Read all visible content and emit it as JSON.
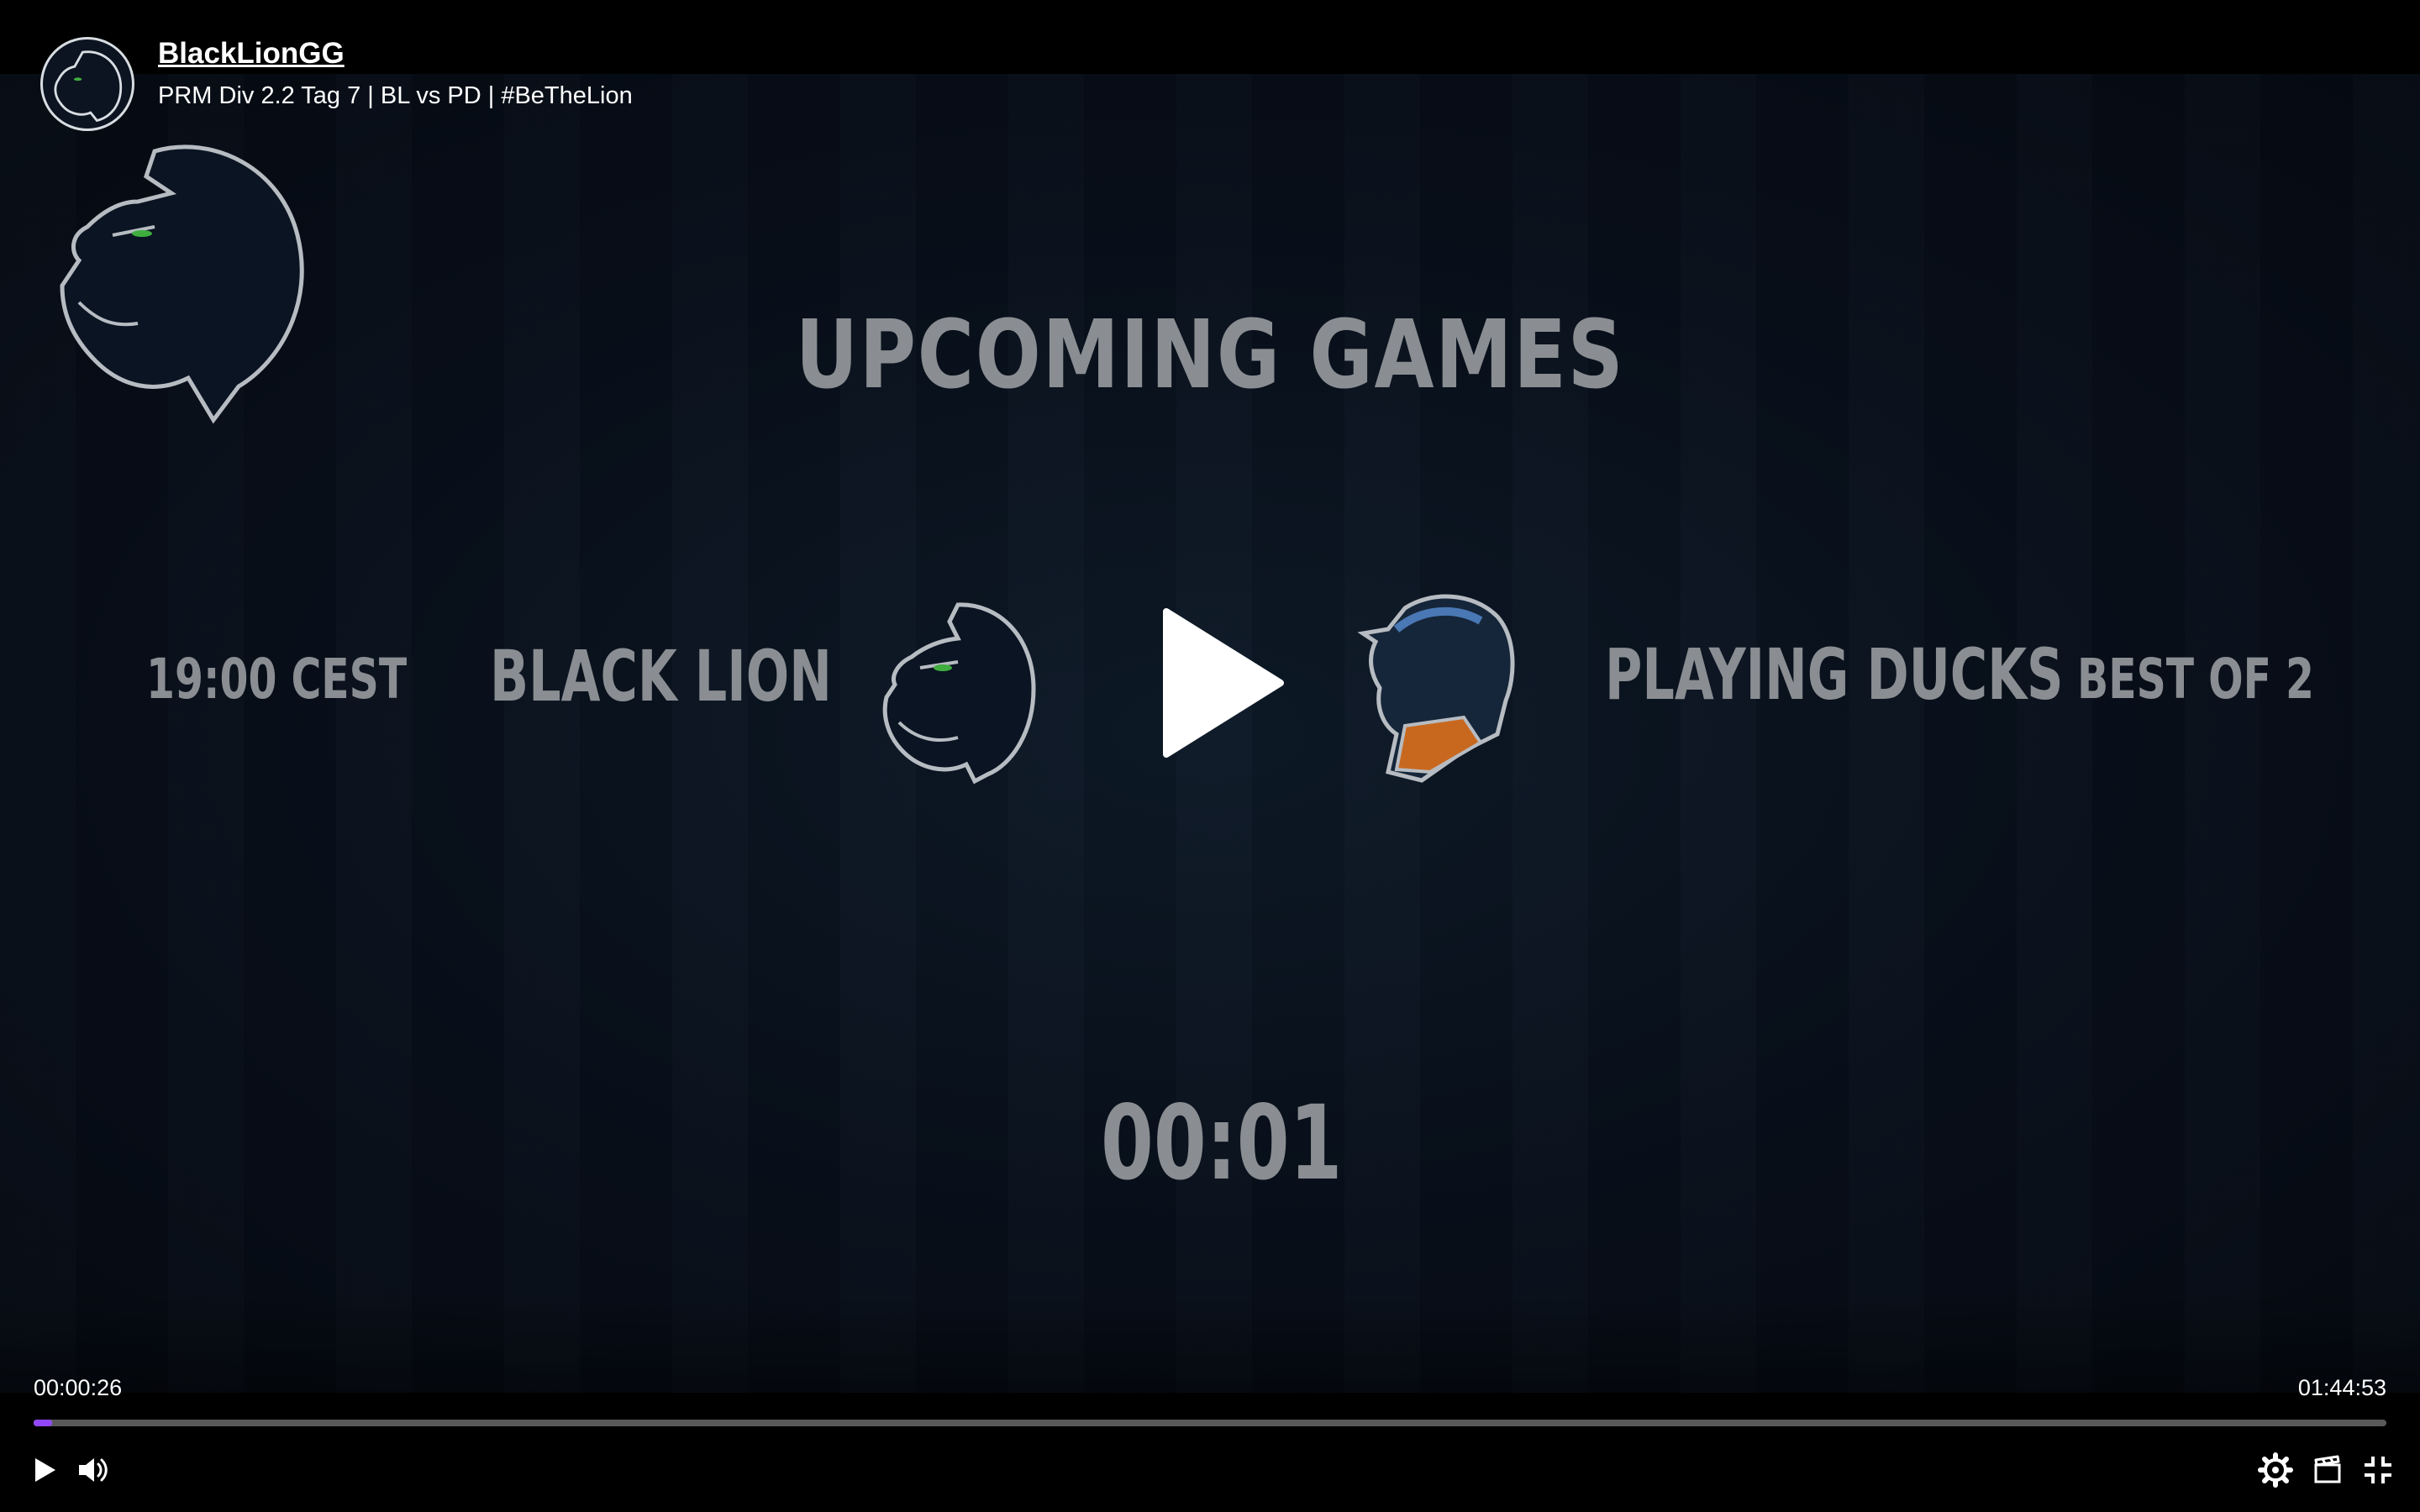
{
  "header": {
    "channel_name": "BlackLionGG",
    "stream_title": "PRM Div 2.2 Tag 7 | BL vs PD | #BeTheLion"
  },
  "overlay": {
    "heading": "UPCOMING GAMES",
    "match_time": "19:00 CEST",
    "team_a": "BLACK LION",
    "team_b": "PLAYING DUCKS",
    "format": "BEST OF 2",
    "countdown": "00:01"
  },
  "player": {
    "current_time": "00:00:26",
    "duration": "01:44:53",
    "progress_fraction": 0.004,
    "buffered_fraction": 0.008,
    "icons": [
      "play-icon",
      "volume-icon",
      "settings-icon",
      "clip-icon",
      "exit-fullscreen-icon"
    ]
  },
  "colors": {
    "accent": "#9147ff",
    "overlay_text": "#8a8e92",
    "duck_beak": "#c8681f"
  }
}
